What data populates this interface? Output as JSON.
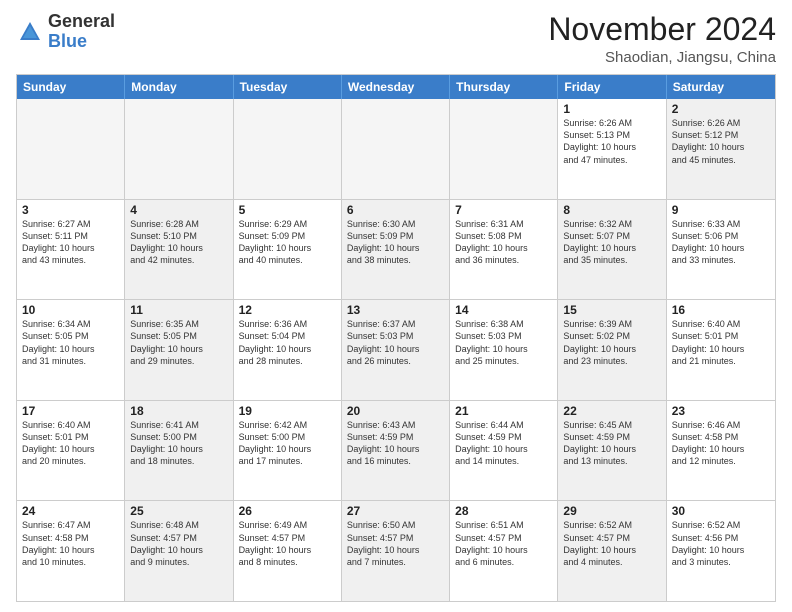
{
  "header": {
    "logo_general": "General",
    "logo_blue": "Blue",
    "month_title": "November 2024",
    "location": "Shaodian, Jiangsu, China"
  },
  "weekdays": [
    "Sunday",
    "Monday",
    "Tuesday",
    "Wednesday",
    "Thursday",
    "Friday",
    "Saturday"
  ],
  "rows": [
    [
      {
        "day": "",
        "empty": true
      },
      {
        "day": "",
        "empty": true
      },
      {
        "day": "",
        "empty": true
      },
      {
        "day": "",
        "empty": true
      },
      {
        "day": "",
        "empty": true
      },
      {
        "day": "1",
        "lines": [
          "Sunrise: 6:26 AM",
          "Sunset: 5:13 PM",
          "Daylight: 10 hours",
          "and 47 minutes."
        ]
      },
      {
        "day": "2",
        "shaded": true,
        "lines": [
          "Sunrise: 6:26 AM",
          "Sunset: 5:12 PM",
          "Daylight: 10 hours",
          "and 45 minutes."
        ]
      }
    ],
    [
      {
        "day": "3",
        "lines": [
          "Sunrise: 6:27 AM",
          "Sunset: 5:11 PM",
          "Daylight: 10 hours",
          "and 43 minutes."
        ]
      },
      {
        "day": "4",
        "shaded": true,
        "lines": [
          "Sunrise: 6:28 AM",
          "Sunset: 5:10 PM",
          "Daylight: 10 hours",
          "and 42 minutes."
        ]
      },
      {
        "day": "5",
        "lines": [
          "Sunrise: 6:29 AM",
          "Sunset: 5:09 PM",
          "Daylight: 10 hours",
          "and 40 minutes."
        ]
      },
      {
        "day": "6",
        "shaded": true,
        "lines": [
          "Sunrise: 6:30 AM",
          "Sunset: 5:09 PM",
          "Daylight: 10 hours",
          "and 38 minutes."
        ]
      },
      {
        "day": "7",
        "lines": [
          "Sunrise: 6:31 AM",
          "Sunset: 5:08 PM",
          "Daylight: 10 hours",
          "and 36 minutes."
        ]
      },
      {
        "day": "8",
        "shaded": true,
        "lines": [
          "Sunrise: 6:32 AM",
          "Sunset: 5:07 PM",
          "Daylight: 10 hours",
          "and 35 minutes."
        ]
      },
      {
        "day": "9",
        "lines": [
          "Sunrise: 6:33 AM",
          "Sunset: 5:06 PM",
          "Daylight: 10 hours",
          "and 33 minutes."
        ]
      }
    ],
    [
      {
        "day": "10",
        "lines": [
          "Sunrise: 6:34 AM",
          "Sunset: 5:05 PM",
          "Daylight: 10 hours",
          "and 31 minutes."
        ]
      },
      {
        "day": "11",
        "shaded": true,
        "lines": [
          "Sunrise: 6:35 AM",
          "Sunset: 5:05 PM",
          "Daylight: 10 hours",
          "and 29 minutes."
        ]
      },
      {
        "day": "12",
        "lines": [
          "Sunrise: 6:36 AM",
          "Sunset: 5:04 PM",
          "Daylight: 10 hours",
          "and 28 minutes."
        ]
      },
      {
        "day": "13",
        "shaded": true,
        "lines": [
          "Sunrise: 6:37 AM",
          "Sunset: 5:03 PM",
          "Daylight: 10 hours",
          "and 26 minutes."
        ]
      },
      {
        "day": "14",
        "lines": [
          "Sunrise: 6:38 AM",
          "Sunset: 5:03 PM",
          "Daylight: 10 hours",
          "and 25 minutes."
        ]
      },
      {
        "day": "15",
        "shaded": true,
        "lines": [
          "Sunrise: 6:39 AM",
          "Sunset: 5:02 PM",
          "Daylight: 10 hours",
          "and 23 minutes."
        ]
      },
      {
        "day": "16",
        "lines": [
          "Sunrise: 6:40 AM",
          "Sunset: 5:01 PM",
          "Daylight: 10 hours",
          "and 21 minutes."
        ]
      }
    ],
    [
      {
        "day": "17",
        "lines": [
          "Sunrise: 6:40 AM",
          "Sunset: 5:01 PM",
          "Daylight: 10 hours",
          "and 20 minutes."
        ]
      },
      {
        "day": "18",
        "shaded": true,
        "lines": [
          "Sunrise: 6:41 AM",
          "Sunset: 5:00 PM",
          "Daylight: 10 hours",
          "and 18 minutes."
        ]
      },
      {
        "day": "19",
        "lines": [
          "Sunrise: 6:42 AM",
          "Sunset: 5:00 PM",
          "Daylight: 10 hours",
          "and 17 minutes."
        ]
      },
      {
        "day": "20",
        "shaded": true,
        "lines": [
          "Sunrise: 6:43 AM",
          "Sunset: 4:59 PM",
          "Daylight: 10 hours",
          "and 16 minutes."
        ]
      },
      {
        "day": "21",
        "lines": [
          "Sunrise: 6:44 AM",
          "Sunset: 4:59 PM",
          "Daylight: 10 hours",
          "and 14 minutes."
        ]
      },
      {
        "day": "22",
        "shaded": true,
        "lines": [
          "Sunrise: 6:45 AM",
          "Sunset: 4:59 PM",
          "Daylight: 10 hours",
          "and 13 minutes."
        ]
      },
      {
        "day": "23",
        "lines": [
          "Sunrise: 6:46 AM",
          "Sunset: 4:58 PM",
          "Daylight: 10 hours",
          "and 12 minutes."
        ]
      }
    ],
    [
      {
        "day": "24",
        "lines": [
          "Sunrise: 6:47 AM",
          "Sunset: 4:58 PM",
          "Daylight: 10 hours",
          "and 10 minutes."
        ]
      },
      {
        "day": "25",
        "shaded": true,
        "lines": [
          "Sunrise: 6:48 AM",
          "Sunset: 4:57 PM",
          "Daylight: 10 hours",
          "and 9 minutes."
        ]
      },
      {
        "day": "26",
        "lines": [
          "Sunrise: 6:49 AM",
          "Sunset: 4:57 PM",
          "Daylight: 10 hours",
          "and 8 minutes."
        ]
      },
      {
        "day": "27",
        "shaded": true,
        "lines": [
          "Sunrise: 6:50 AM",
          "Sunset: 4:57 PM",
          "Daylight: 10 hours",
          "and 7 minutes."
        ]
      },
      {
        "day": "28",
        "lines": [
          "Sunrise: 6:51 AM",
          "Sunset: 4:57 PM",
          "Daylight: 10 hours",
          "and 6 minutes."
        ]
      },
      {
        "day": "29",
        "shaded": true,
        "lines": [
          "Sunrise: 6:52 AM",
          "Sunset: 4:57 PM",
          "Daylight: 10 hours",
          "and 4 minutes."
        ]
      },
      {
        "day": "30",
        "lines": [
          "Sunrise: 6:52 AM",
          "Sunset: 4:56 PM",
          "Daylight: 10 hours",
          "and 3 minutes."
        ]
      }
    ]
  ]
}
